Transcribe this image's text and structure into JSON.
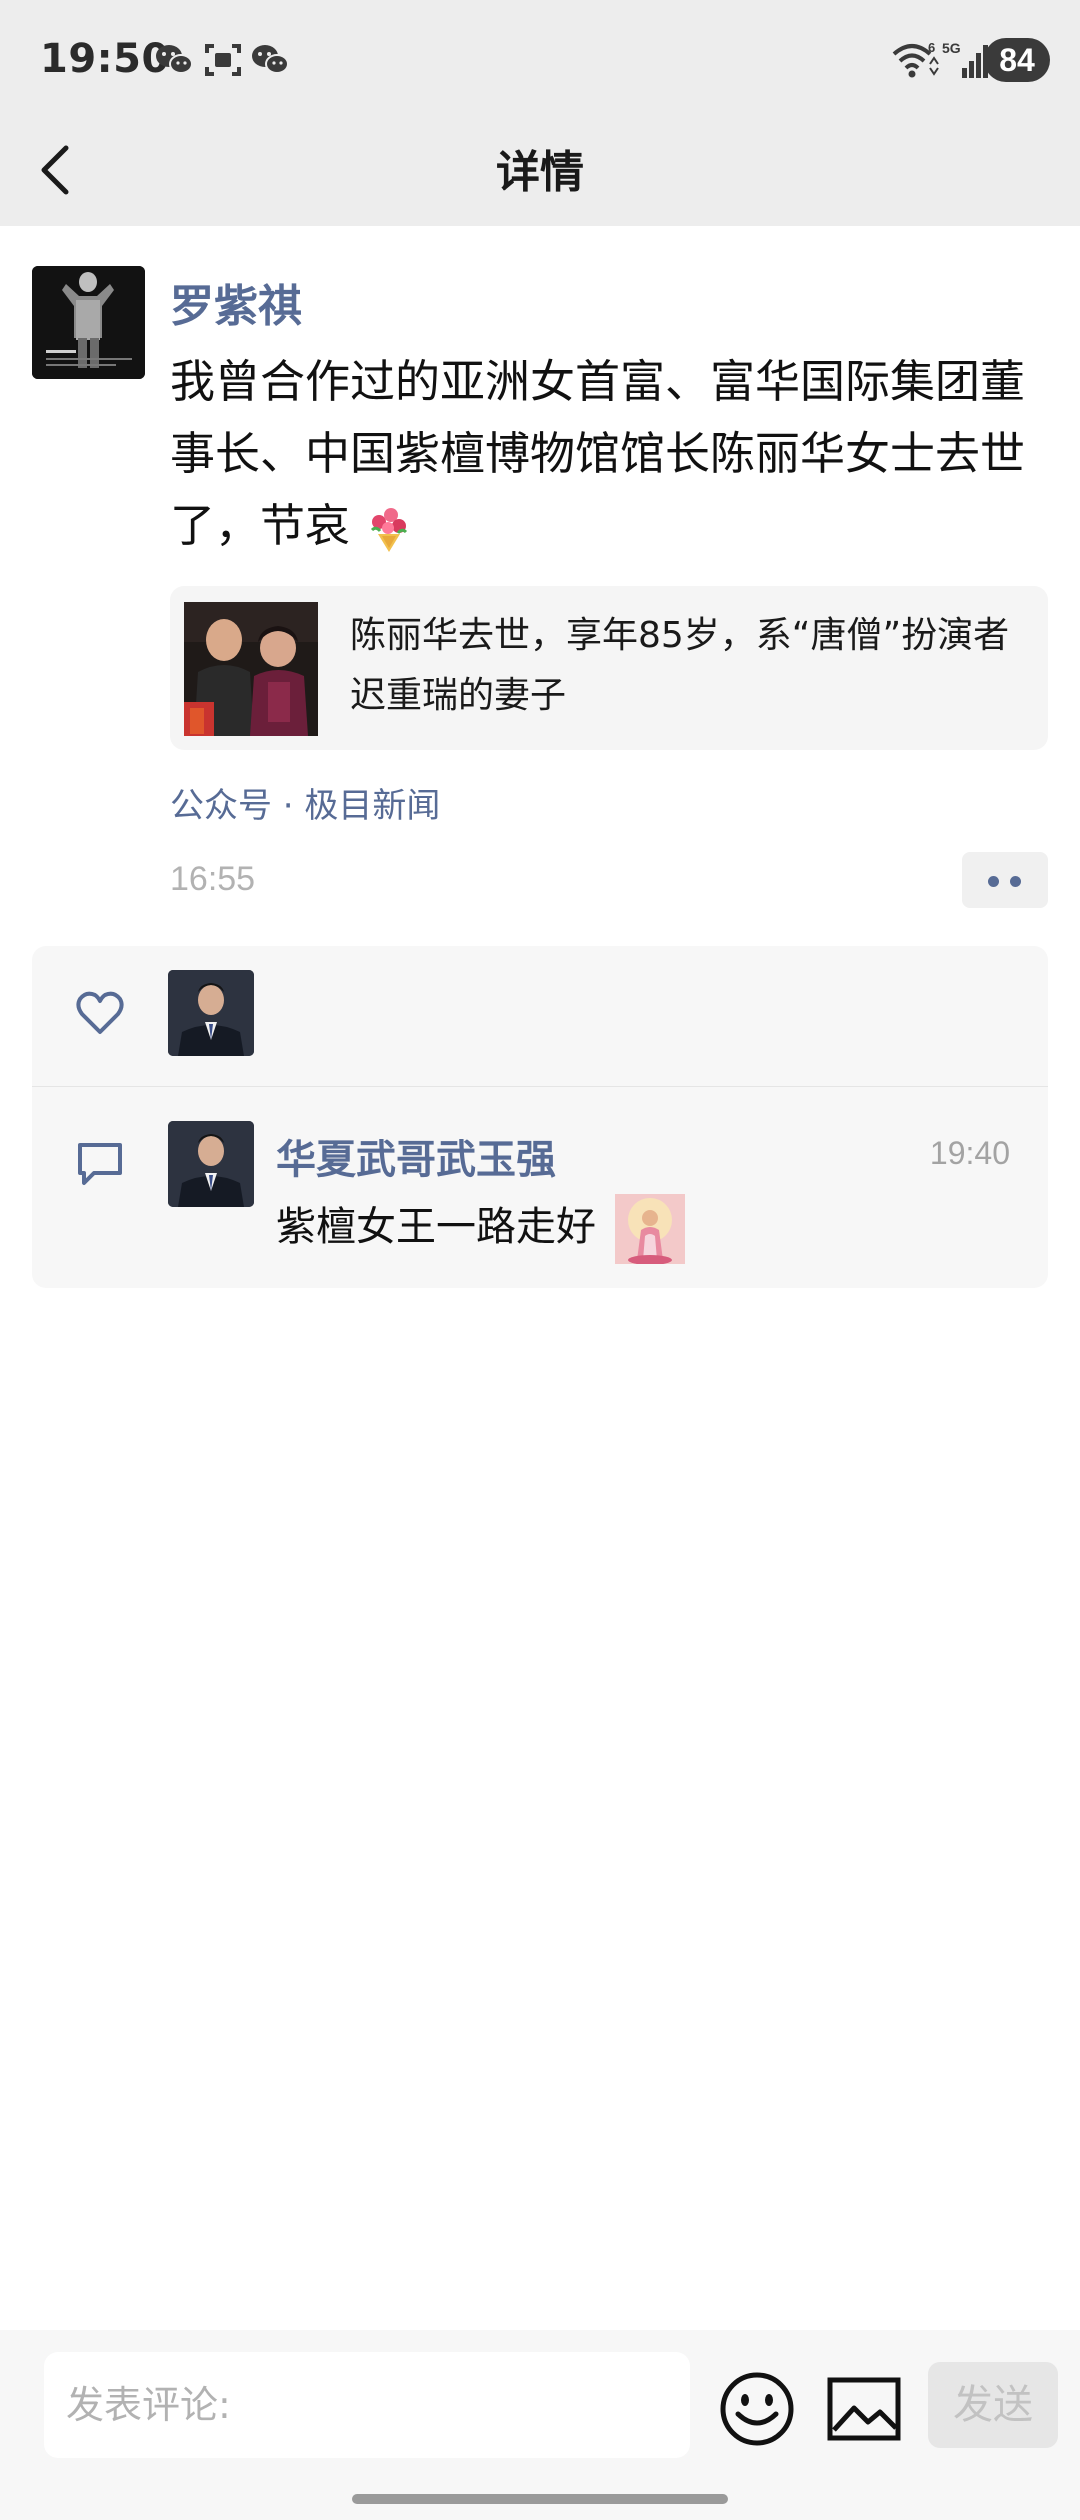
{
  "status_bar": {
    "time": "19:50",
    "battery": "84",
    "network": "5G",
    "wifi_badge": "6",
    "icons": [
      "wechat-icon",
      "scan-icon",
      "wechat-icon",
      "wifi-icon",
      "signal-icon"
    ]
  },
  "header": {
    "title": "详情",
    "back_icon": "chevron-left-icon"
  },
  "post": {
    "author": "罗紫祺",
    "text": "我曾合作过的亚洲女首富、富华国际集团董事长、中国紫檀博物馆馆长陈丽华女士去世了，节哀",
    "text_emoji": "bouquet-icon",
    "link": {
      "title": "陈丽华去世，享年85岁，系“唐僧”扮演者迟重瑞的妻子"
    },
    "source": "公众号 · 极目新闻",
    "time": "16:55"
  },
  "interactions": {
    "like_icon": "heart-icon",
    "comment_icon": "comment-icon",
    "comments": [
      {
        "name": "华夏武哥武玉强",
        "time": "19:40",
        "text": "紫檀女王一路走好"
      }
    ]
  },
  "composer": {
    "placeholder": "发表评论:",
    "send_label": "发送"
  },
  "colors": {
    "link_blue": "#576b95",
    "header_bg": "#ededed",
    "panel_bg": "#f7f7f7"
  }
}
